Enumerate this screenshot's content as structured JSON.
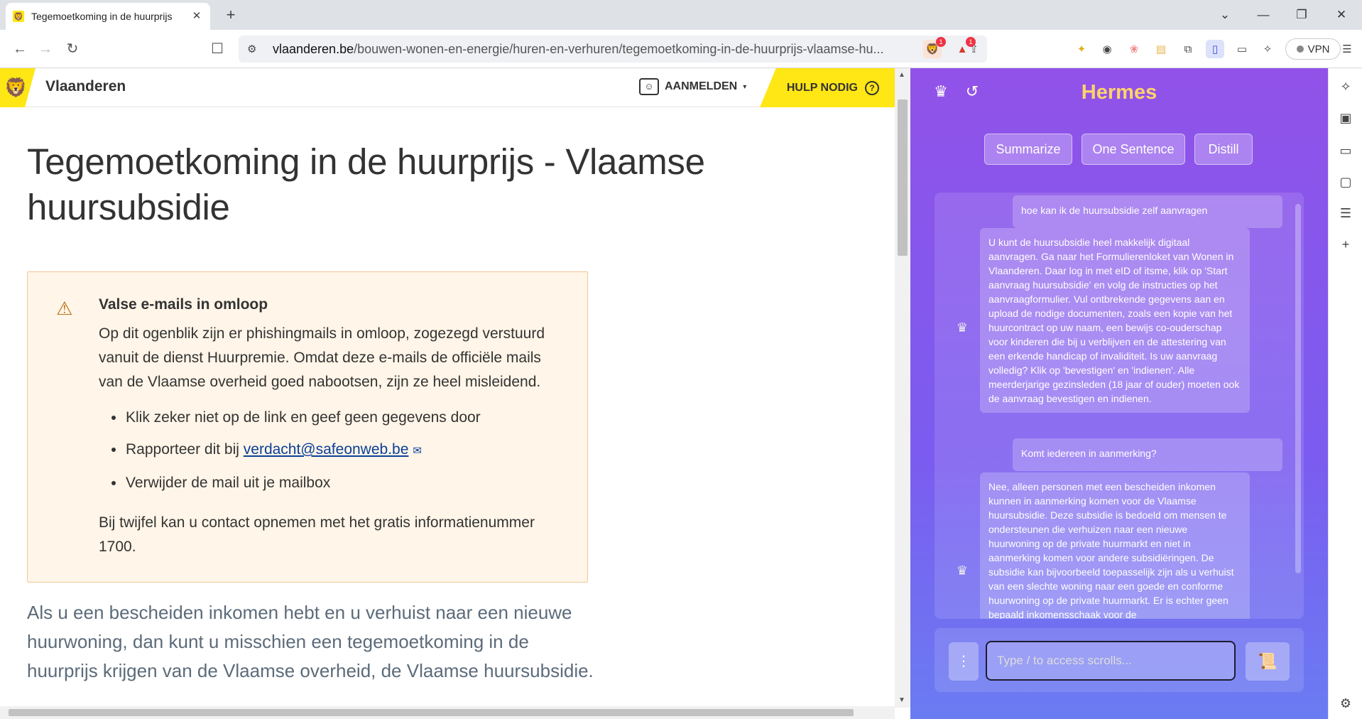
{
  "tab": {
    "title": "Tegemoetkoming in de huurprijs",
    "close": "✕"
  },
  "new_tab_label": "+",
  "window_controls": {
    "dropdown": "⌄",
    "minimize": "—",
    "restore": "❐",
    "close": "✕"
  },
  "toolbar": {
    "back": "←",
    "forward": "→",
    "reload": "↻",
    "bookmark": "☐",
    "url_domain": "vlaanderen.be",
    "url_path": "/bouwen-wonen-en-energie/huren-en-verhuren/tegemoetkoming-in-de-huurprijs-vlaamse-hu...",
    "extension_badges": [
      "1",
      "1"
    ],
    "vpn_label": "VPN"
  },
  "site_header": {
    "name": "Vlaanderen",
    "login_label": "AANMELDEN",
    "help_label": "HULP NODIG"
  },
  "page": {
    "title": "Tegemoetkoming in de huurprijs - Vlaamse huursubsidie",
    "alert": {
      "title": "Valse e-mails in omloop",
      "body": "Op dit ogenblik zijn er phishingmails in omloop, zogezegd verstuurd vanuit de dienst Huurpremie. Omdat deze e-mails de officiële mails van de Vlaamse overheid goed nabootsen, zijn ze heel misleidend.",
      "bullets": [
        "Klik zeker niet op de link en geef geen gegevens door",
        "Rapporteer dit bij ",
        "Verwijder de mail uit je mailbox"
      ],
      "report_link": "verdacht@safeonweb.be",
      "footer": "Bij twijfel kan u contact opnemen met het gratis informatienummer 1700."
    },
    "intro": "Als u een bescheiden inkomen hebt en u verhuist naar een nieuwe huurwoning, dan kunt u misschien een tegemoetkoming in de huurprijs krijgen van de Vlaamse overheid, de Vlaamse huursubsidie."
  },
  "hermes": {
    "title": "Hermes",
    "actions": [
      "Summarize",
      "One Sentence",
      "Distill"
    ],
    "messages": [
      {
        "role": "user",
        "text": "hoe kan ik de huursubsidie zelf aanvragen"
      },
      {
        "role": "bot",
        "text": "U kunt de huursubsidie heel makkelijk digitaal aanvragen. Ga naar het Formulierenloket van Wonen in Vlaanderen. Daar log in met eID of itsme, klik op 'Start aanvraag huursubsidie' en volg de instructies op het aanvraagformulier. Vul ontbrekende gegevens aan en upload de nodige documenten, zoals een kopie van het huurcontract op uw naam, een bewijs co-ouderschap voor kinderen die bij u verblijven en de attestering van een erkende handicap of invaliditeit. Is uw aanvraag volledig? Klik op 'bevestigen' en 'indienen'. Alle meerderjarige gezinsleden (18 jaar of ouder) moeten ook de aanvraag bevestigen en indienen."
      },
      {
        "role": "user",
        "text": "Komt iedereen in aanmerking?"
      },
      {
        "role": "bot",
        "text": "Nee, alleen personen met een bescheiden inkomen kunnen in aanmerking komen voor de Vlaamse huursubsidie. Deze subsidie is bedoeld om mensen te ondersteunen die verhuizen naar een nieuwe huurwoning op de private huurmarkt en niet in aanmerking komen voor andere subsidiëringen. De subsidie kan bijvoorbeeld toepasselijk zijn als u verhuist van een slechte woning naar een goede en conforme huurwoning op de private huurmarkt. Er is echter geen bepaald inkomensschaak voor de"
      }
    ],
    "input_placeholder": "Type / to access scrolls..."
  },
  "icons": {
    "favicon": "lion-icon",
    "history": "history-icon",
    "agent": "agent-icon",
    "send": "scroll-icon"
  },
  "colors": {
    "flanders_yellow": "#ffe615",
    "hermes_title": "#ffd36b",
    "hermes_bg_top": "#9152e8",
    "hermes_bg_bottom": "#6a7cf2",
    "link": "#0a3f99"
  }
}
